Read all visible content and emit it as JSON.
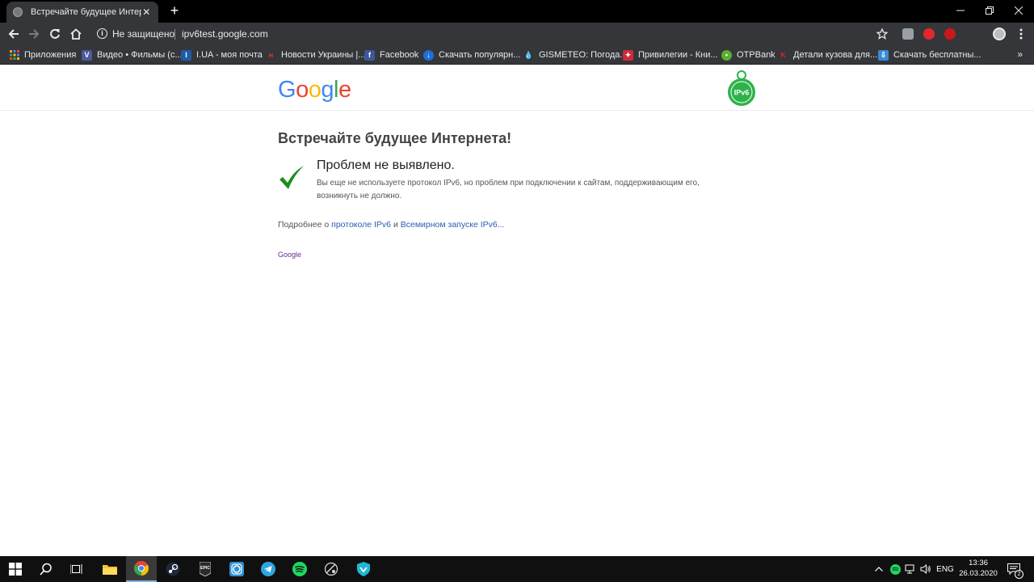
{
  "browser": {
    "tab": {
      "title": "Встречайте будущее Интернета"
    },
    "toolbar": {
      "security_text": "Не защищено",
      "url": "ipv6test.google.com"
    },
    "bookmarks": [
      {
        "label": "Приложения",
        "icon": "apps-grid-icon",
        "color": "#e8a33a"
      },
      {
        "label": "Видео • Фильмы (с...",
        "icon": "v-icon",
        "color": "#4a5a9a"
      },
      {
        "label": "I.UA - моя почта",
        "icon": "iua-icon",
        "color": "#1e5aa8"
      },
      {
        "label": "Новости Украины |...",
        "icon": "news-icon",
        "color": "#d23a2a"
      },
      {
        "label": "Facebook",
        "icon": "facebook-icon",
        "color": "#3b5998"
      },
      {
        "label": "Скачать популярн...",
        "icon": "download-site-icon",
        "color": "#1e6fd9"
      },
      {
        "label": "GISMETEO: Погода...",
        "icon": "drop-icon",
        "color": "#5ab0ff"
      },
      {
        "label": "Привилегии - Кни...",
        "icon": "bookmark-flag-icon",
        "color": "#d02a3a"
      },
      {
        "label": "OTPBank",
        "icon": "otp-icon",
        "color": "#5ab030"
      },
      {
        "label": "Детали кузова для...",
        "icon": "k-icon",
        "color": "#d02a2a"
      },
      {
        "label": "Скачать бесплатны...",
        "icon": "download-arrow-icon",
        "color": "#3a8ad8"
      }
    ]
  },
  "page": {
    "logo_letters": [
      {
        "ch": "G",
        "color": "#4285F4"
      },
      {
        "ch": "o",
        "color": "#EA4335"
      },
      {
        "ch": "o",
        "color": "#FBBC05"
      },
      {
        "ch": "g",
        "color": "#4285F4"
      },
      {
        "ch": "l",
        "color": "#34A853"
      },
      {
        "ch": "e",
        "color": "#EA4335"
      }
    ],
    "badge_text": "IPv6",
    "title": "Встречайте будущее Интернета!",
    "result_title": "Проблем не выявлено.",
    "result_desc": "Вы еще не используете протокол IPv6, но проблем при подключении к сайтам, поддерживающим его, возникнуть не должно.",
    "more_prefix": "Подробнее о ",
    "more_link1": "протоколе IPv6",
    "more_and": " и ",
    "more_link2": "Всемирном запуске IPv6...",
    "footer_link": "Google"
  },
  "taskbar": {
    "apps": [
      "windows-start-icon",
      "search-icon",
      "task-view-icon",
      "file-explorer-icon",
      "chrome-icon",
      "steam-icon",
      "epic-games-icon",
      "instagram-app-icon",
      "telegram-icon",
      "spotify-icon",
      "satellite-app-icon",
      "vpn-shield-icon"
    ],
    "language": "ENG",
    "time": "13:36",
    "date": "26.03.2020",
    "notification_count": "2"
  },
  "colors": {
    "check_green": "#1e8c1e",
    "badge_green": "#2db34a",
    "link_blue": "#2a5db0"
  }
}
